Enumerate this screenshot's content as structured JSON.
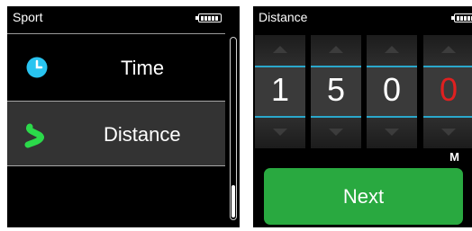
{
  "sport_screen": {
    "title": "Sport",
    "items": [
      {
        "label": "Time",
        "icon": "clock-icon",
        "icon_color": "#29c4f0",
        "selected": false
      },
      {
        "label": "Distance",
        "icon": "route-icon",
        "icon_color": "#2bd94a",
        "selected": true
      }
    ]
  },
  "distance_screen": {
    "title": "Distance",
    "digits": [
      "1",
      "5",
      "0",
      "0"
    ],
    "active_digit_color": "#e02020",
    "unit": "M",
    "next_label": "Next",
    "button_color": "#29a940",
    "accent_color": "#2aa8cc"
  }
}
